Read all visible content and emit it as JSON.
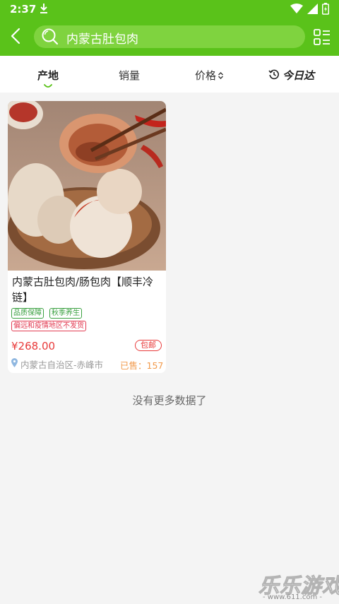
{
  "status_bar": {
    "time": "2:37",
    "icons": [
      "download-icon",
      "wifi-icon",
      "signal-icon",
      "battery-icon"
    ]
  },
  "header": {
    "search_text": "内蒙古肚包肉",
    "icons": [
      "back-arrow-icon",
      "search-icon",
      "list-menu-icon"
    ],
    "accent_color": "#5ac21a"
  },
  "sort_bar": {
    "origin_label": "产地",
    "sales_label": "销量",
    "price_label": "价格",
    "today_label": "今日达",
    "active": "产地"
  },
  "product": {
    "title": "内蒙古肚包肉/肠包肉【顺丰冷链】",
    "tags": [
      "品质保障",
      "秋季养生"
    ],
    "notice": "偏远和疫情地区不发货",
    "price": "¥268.00",
    "shipping_badge": "包邮",
    "location": "内蒙古自治区-赤峰市",
    "sold": "已售：157",
    "price_color": "#e83a3a"
  },
  "footer": {
    "end_text": "没有更多数据了"
  },
  "watermark": {
    "main": "乐乐游戏",
    "sub": "- www.611.com -"
  }
}
